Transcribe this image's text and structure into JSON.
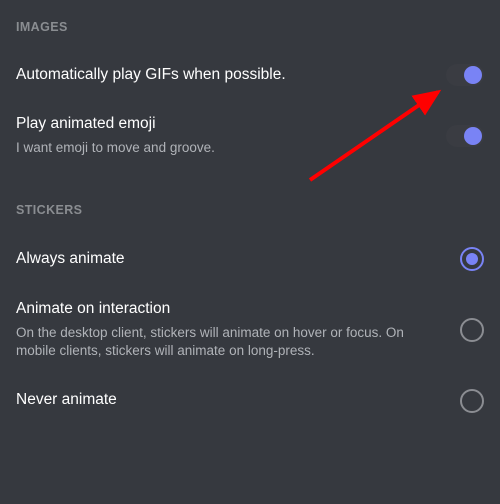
{
  "sections": {
    "images": {
      "header": "IMAGES",
      "items": [
        {
          "key": "auto_gif",
          "title": "Automatically play GIFs when possible.",
          "subtitle": "",
          "toggle_on": true
        },
        {
          "key": "animated_emoji",
          "title": "Play animated emoji",
          "subtitle": "I want emoji to move and groove.",
          "toggle_on": true
        }
      ]
    },
    "stickers": {
      "header": "STICKERS",
      "items": [
        {
          "key": "always",
          "title": "Always animate",
          "subtitle": "",
          "selected": true
        },
        {
          "key": "on_interaction",
          "title": "Animate on interaction",
          "subtitle": "On the desktop client, stickers will animate on hover or focus. On mobile clients, stickers will animate on long-press.",
          "selected": false
        },
        {
          "key": "never",
          "title": "Never animate",
          "subtitle": "",
          "selected": false
        }
      ]
    }
  },
  "colors": {
    "background": "#36393f",
    "accent": "#7983f5",
    "text_primary": "#ffffff",
    "text_secondary": "#b0b3b8",
    "text_muted": "#8a8d91",
    "annotation": "#ff0000"
  }
}
